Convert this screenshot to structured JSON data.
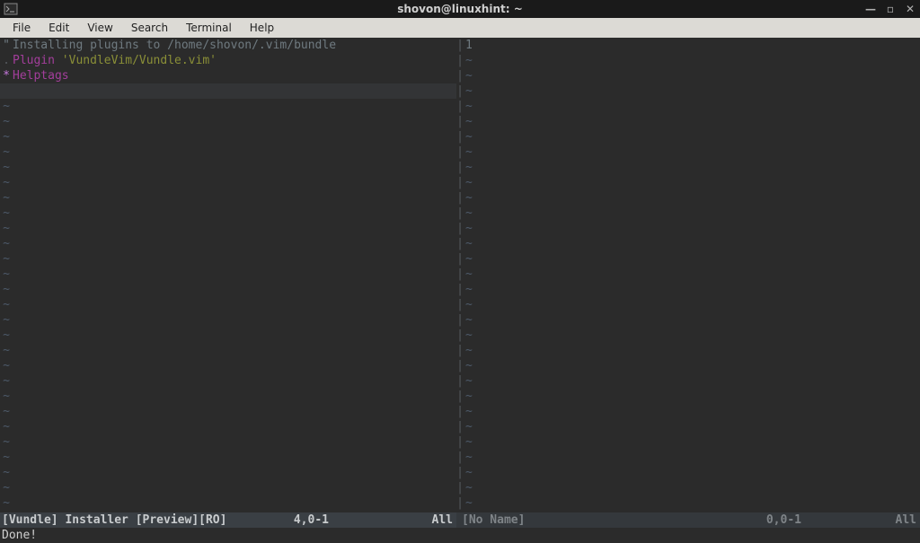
{
  "window": {
    "title": "shovon@linuxhint: ~"
  },
  "menu": {
    "file": "File",
    "edit": "Edit",
    "view": "View",
    "search": "Search",
    "terminal": "Terminal",
    "help": "Help"
  },
  "left": {
    "comment_marker": "\"",
    "comment_text": "Installing plugins to /home/shovon/.vim/bundle",
    "dot": ".",
    "plugin_kw": "Plugin",
    "plugin_name": "'VundleVim/Vundle.vim'",
    "star": "*",
    "helptags": "Helptags"
  },
  "status": {
    "left_name": "[Vundle] Installer [Preview][RO]",
    "left_pos": "4,0-1",
    "left_all": "All",
    "right_name": "[No Name]",
    "right_pos": "0,0-1",
    "right_all": "All"
  },
  "message": "Done!",
  "right_first_char": "1"
}
